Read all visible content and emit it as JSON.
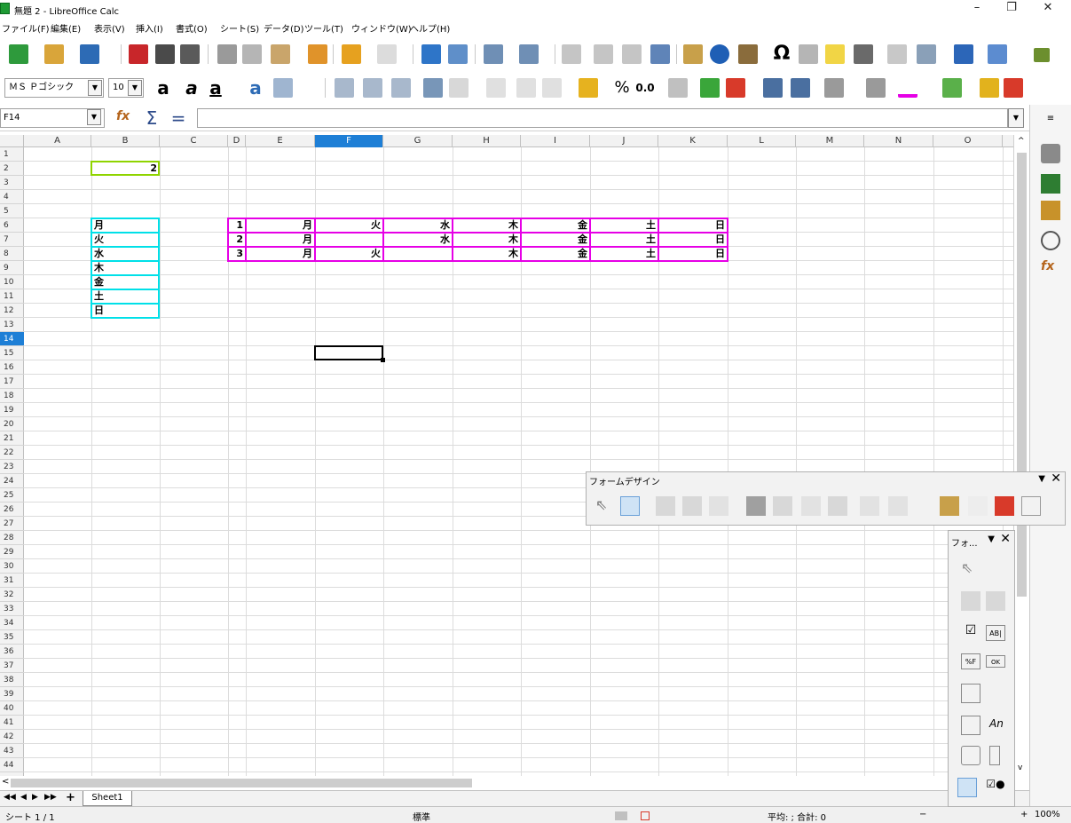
{
  "window": {
    "title": "無題 2 - LibreOffice Calc",
    "minimize": "–",
    "maximize": "❐",
    "close": "✕",
    "account_icon": "person-icon"
  },
  "menubar": [
    "ファイル(F)",
    "編集(E)",
    "表示(V)",
    "挿入(I)",
    "書式(O)",
    "シート(S)",
    "データ(D)",
    "ツール(T)",
    "ウィンドウ(W)",
    "ヘルプ(H)"
  ],
  "toolbar": {
    "font_name": "ＭＳ Ｐゴシック",
    "font_size": "10",
    "percent_label": "%",
    "decimal_label": "0.0"
  },
  "formula_bar": {
    "name_box": "F14",
    "formula": ""
  },
  "columns": [
    "A",
    "B",
    "C",
    "D",
    "E",
    "F",
    "G",
    "H",
    "I",
    "J",
    "K",
    "L",
    "M",
    "N",
    "O"
  ],
  "selected_column": "F",
  "rows": [
    "1",
    "2",
    "3",
    "4",
    "5",
    "6",
    "7",
    "8",
    "9",
    "10",
    "11",
    "12",
    "13",
    "14",
    "15",
    "16",
    "17",
    "18",
    "19",
    "20",
    "21",
    "22",
    "23",
    "24",
    "25",
    "26",
    "27",
    "28",
    "29",
    "30",
    "31",
    "32",
    "33",
    "34",
    "35",
    "36",
    "37",
    "38",
    "39",
    "40",
    "41",
    "42",
    "43",
    "44"
  ],
  "selected_row": "14",
  "cells": {
    "B1": "2",
    "B5": "月",
    "B6": "火",
    "B7": "水",
    "B8": "木",
    "B9": "金",
    "B10": "土",
    "B11": "日",
    "D5": "1",
    "E5": "月",
    "F5": "火",
    "G5": "水",
    "H5": "木",
    "I5": "金",
    "J5": "土",
    "K5": "日",
    "D6": "2",
    "E6": "月",
    "F6": "",
    "G6": "水",
    "H6": "木",
    "I6": "金",
    "J6": "土",
    "K6": "日",
    "D7": "3",
    "E7": "月",
    "F7": "火",
    "G7": "",
    "H7": "木",
    "I7": "金",
    "J7": "土",
    "K7": "日"
  },
  "colors": {
    "range_b1": "#8fd400",
    "range_b5_b11": "#00e0e8",
    "range_d5_k7": "#e600e6",
    "selection_header": "#1e7fd6"
  },
  "sheet_tabs": {
    "nav": [
      "◀◀",
      "◀",
      "▶",
      "▶▶"
    ],
    "add": "+",
    "tabs": [
      "Sheet1"
    ]
  },
  "statusbar": {
    "sheet_info": "シート 1 / 1",
    "style": "標準",
    "sum_info": "平均: ; 合計: 0",
    "zoom": "100%",
    "zoom_minus": "−",
    "zoom_plus": "+"
  },
  "form_design_toolbar": {
    "title": "フォームデザイン",
    "menu": "▼",
    "close": "✕"
  },
  "form_controls_toolbar": {
    "title": "フォ...",
    "menu": "▼",
    "close": "✕",
    "label_text_field": "AB|",
    "label_formatted": "%F",
    "label_button": "OK",
    "label_an": "An"
  }
}
